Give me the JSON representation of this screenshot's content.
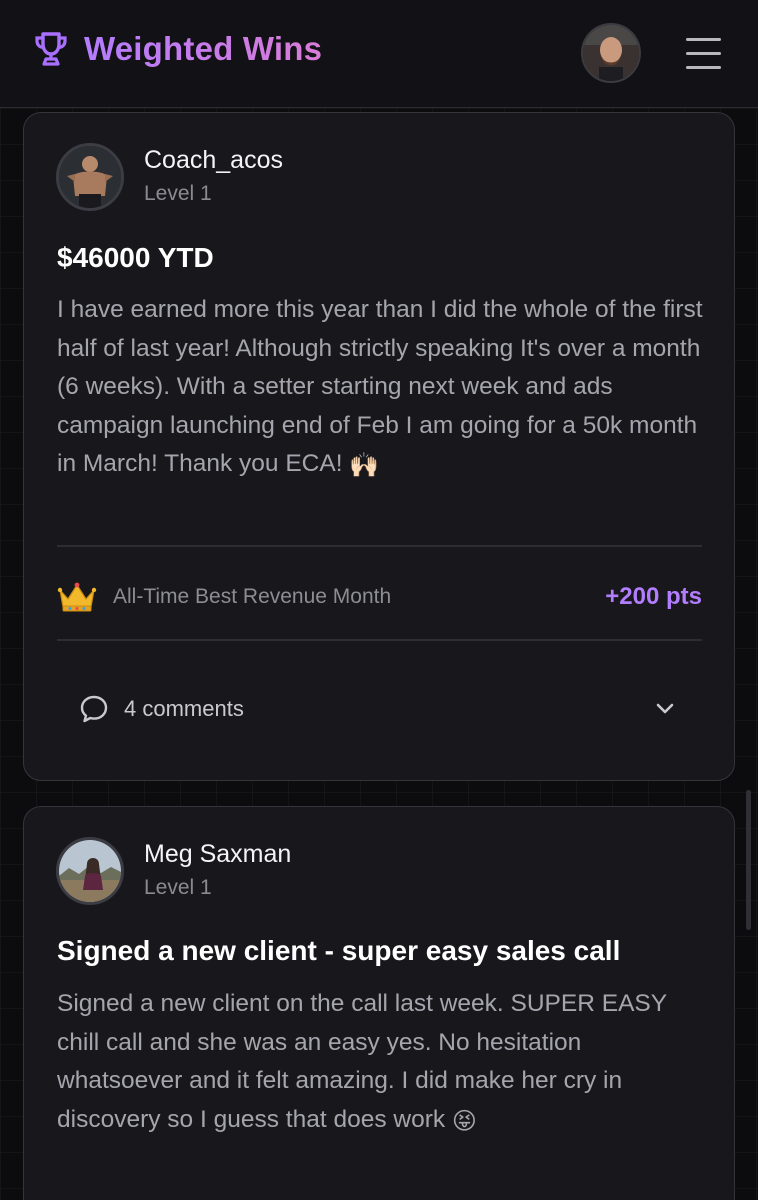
{
  "header": {
    "app_title": "Weighted Wins",
    "trophy_color": "#a970ff",
    "accent_gradient": [
      "#b47cff",
      "#d87cd6"
    ]
  },
  "posts": [
    {
      "author": "Coach_acos",
      "level": "Level 1",
      "title": "$46000 YTD",
      "body": "I have earned more this year than I did the whole of the first half of last year! Although strictly speaking It's over a month (6 weeks). With a setter starting next week and ads campaign launching end of Feb I am going for a 50k month in March! Thank you ECA!",
      "body_emoji": "🙌🏻",
      "achievement": {
        "icon": "crown-icon",
        "label": "All-Time Best Revenue Month",
        "points": "+200 pts",
        "points_color": "#b27dff"
      },
      "comments": {
        "label": "4 comments",
        "icon": "comment-bubble-icon"
      }
    },
    {
      "author": "Meg Saxman",
      "level": "Level 1",
      "title": "Signed a new client - super easy sales call",
      "body": "Signed a new client on the call last week. SUPER EASY chill call and she was an easy yes. No hesitation whatsoever and it felt amazing. I did make her cry in discovery so I guess that does work",
      "body_emoji": "😝"
    }
  ]
}
